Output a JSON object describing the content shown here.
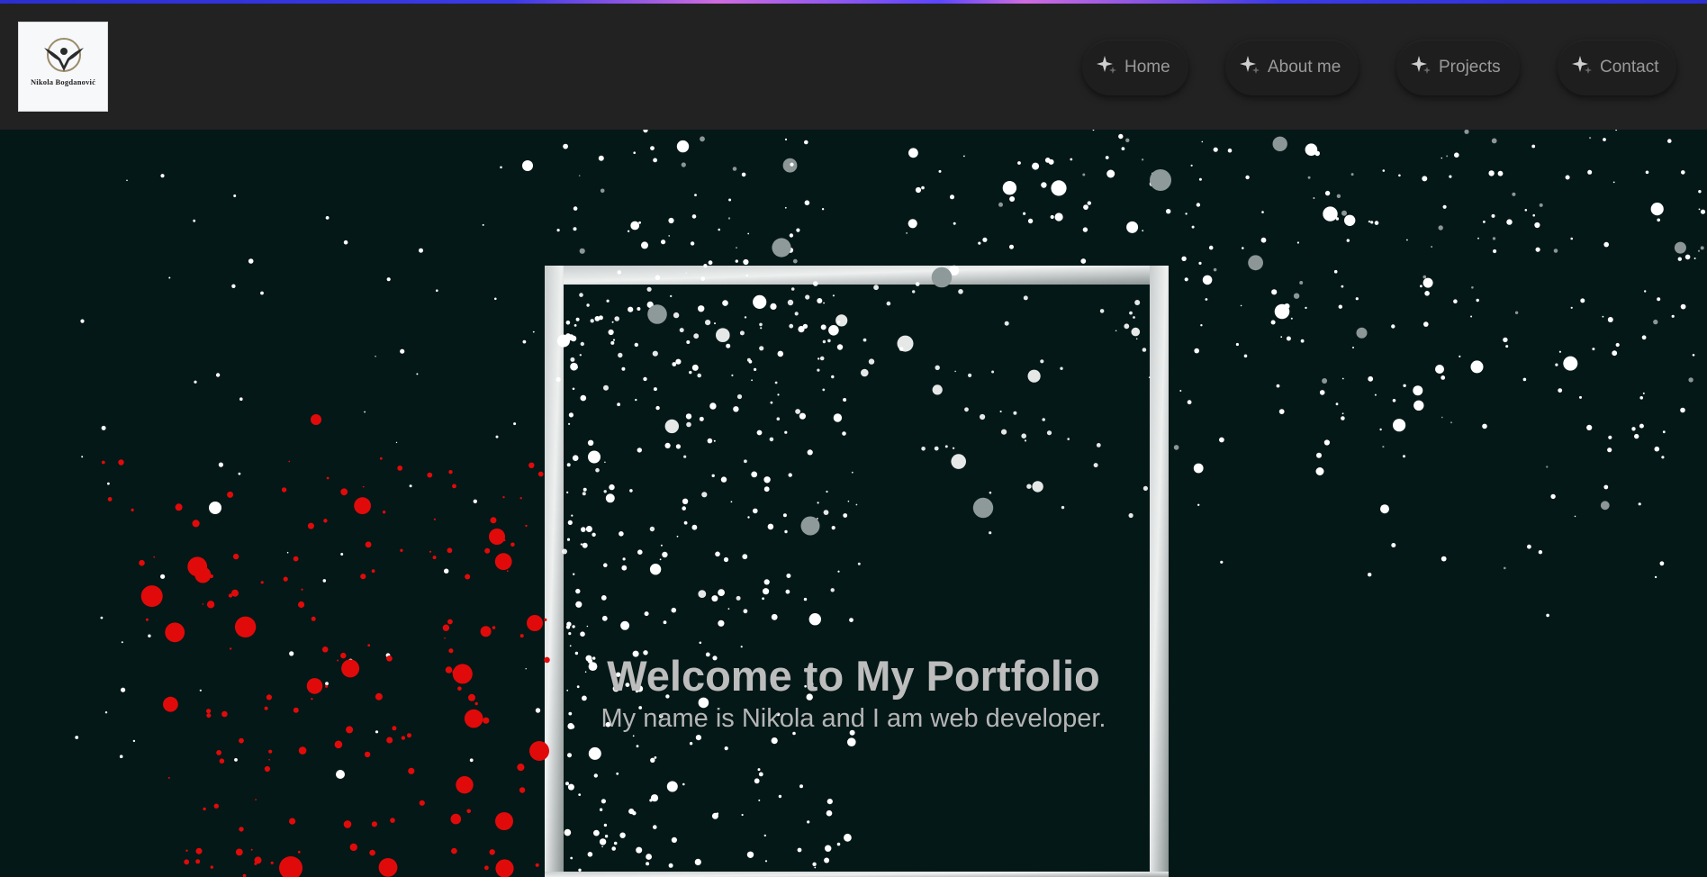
{
  "logo": {
    "text": "Nikola Bogdanović"
  },
  "nav": {
    "home": "Home",
    "about": "About me",
    "projects": "Projects",
    "contact": "Contact"
  },
  "hero": {
    "title": "Welcome to My Portfolio",
    "subtitle": "My name is Nikola and I am web developer."
  },
  "colors": {
    "header_bg": "#222222",
    "hero_bg": "#041817",
    "splatter_red": "#e10a0a",
    "text": "#bdbdbd"
  },
  "icons": {
    "nav_icon": "sparkle-icon"
  }
}
